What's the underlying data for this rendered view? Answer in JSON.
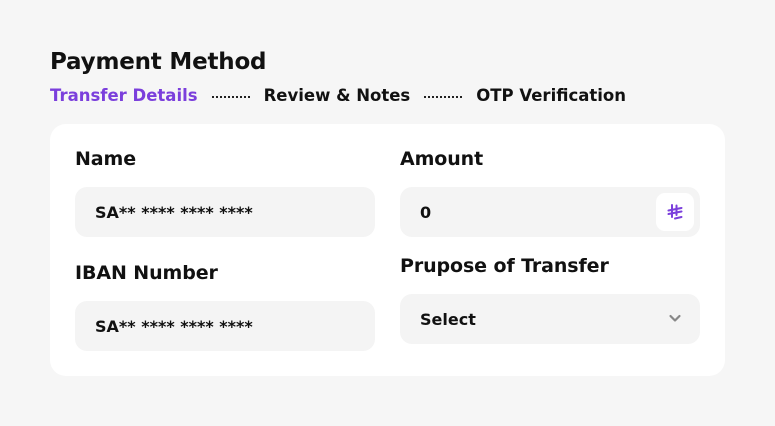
{
  "page": {
    "title": "Payment Method"
  },
  "stepper": {
    "steps": [
      {
        "label": "Transfer Details",
        "active": true
      },
      {
        "label": "Review & Notes",
        "active": false
      },
      {
        "label": "OTP Verification",
        "active": false
      }
    ]
  },
  "form": {
    "name": {
      "label": "Name",
      "value": "SA** **** **** ****"
    },
    "amount": {
      "label": "Amount",
      "value": "0",
      "currency_icon": "saudi-riyal-icon"
    },
    "iban": {
      "label": "IBAN Number",
      "value": "SA** **** **** ****"
    },
    "purpose": {
      "label": "Prupose of Transfer",
      "selected": "Select",
      "icon": "chevron-down-icon"
    }
  },
  "colors": {
    "accent": "#7b3fdc",
    "page_background": "#f6f6f6",
    "card_background": "#ffffff",
    "input_background": "#f4f4f4",
    "text": "#111111"
  }
}
